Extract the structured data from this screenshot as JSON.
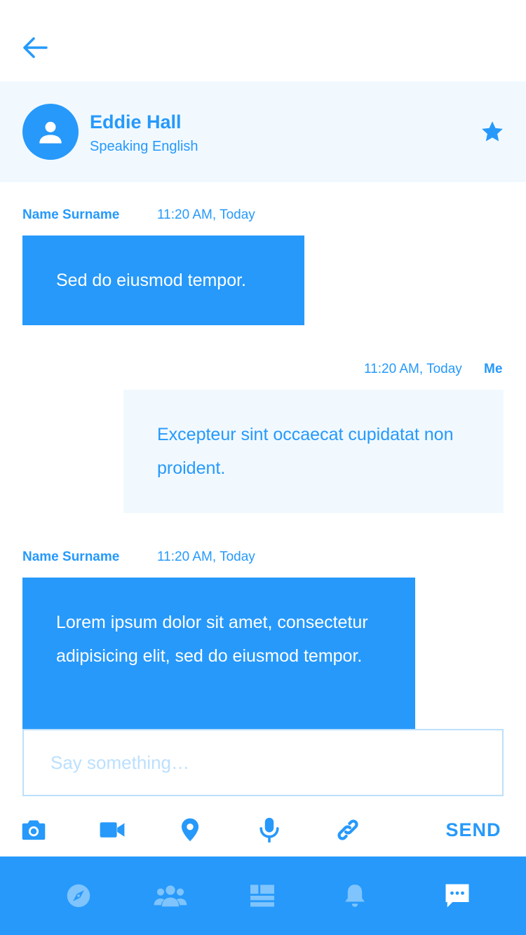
{
  "contact": {
    "name": "Eddie Hall",
    "subtitle": "Speaking English"
  },
  "messages": [
    {
      "sender": "Name Surname",
      "time": "11:20 AM, Today",
      "text": "Sed do eiusmod tempor.",
      "direction": "incoming"
    },
    {
      "sender": "Me",
      "time": "11:20 AM, Today",
      "text": "Excepteur sint occaecat cupidatat non proident.",
      "direction": "outgoing"
    },
    {
      "sender": "Name Surname",
      "time": "11:20 AM, Today",
      "text": "Lorem ipsum dolor sit amet, consectetur adipisicing elit, sed do eiusmod tempor.",
      "direction": "incoming"
    }
  ],
  "composer": {
    "placeholder": "Say something…",
    "send_label": "SEND",
    "tools": [
      "camera-icon",
      "video-icon",
      "location-pin-icon",
      "microphone-icon",
      "link-icon"
    ]
  },
  "bottom_nav": {
    "items": [
      "compass-icon",
      "group-icon",
      "dashboard-icon",
      "bell-icon",
      "chat-icon"
    ],
    "active": "chat-icon"
  },
  "colors": {
    "accent": "#2699fb",
    "light_background": "#f1f9ff",
    "border": "#bce0fd",
    "inactive_nav_icon": "#7fc4fd"
  }
}
